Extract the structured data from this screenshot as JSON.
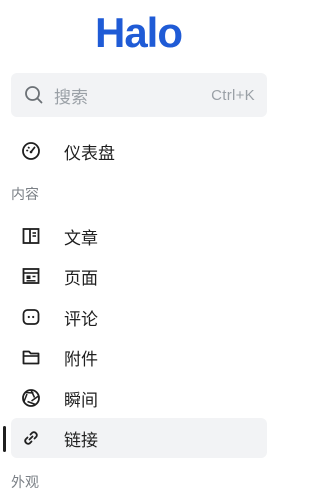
{
  "logo": {
    "text": "Halo",
    "color": "#1f5bd6"
  },
  "search": {
    "placeholder": "搜索",
    "shortcut": "Ctrl+K",
    "icon": "search-icon"
  },
  "nav": {
    "dashboard": {
      "label": "仪表盘",
      "icon": "gauge-icon"
    },
    "groups": {
      "content": "内容",
      "appearance": "外观"
    },
    "items": [
      {
        "label": "文章",
        "icon": "book-icon"
      },
      {
        "label": "页面",
        "icon": "page-icon"
      },
      {
        "label": "评论",
        "icon": "comment-icon"
      },
      {
        "label": "附件",
        "icon": "folder-icon"
      },
      {
        "label": "瞬间",
        "icon": "aperture-icon"
      },
      {
        "label": "链接",
        "icon": "link-icon",
        "active": true
      }
    ]
  }
}
